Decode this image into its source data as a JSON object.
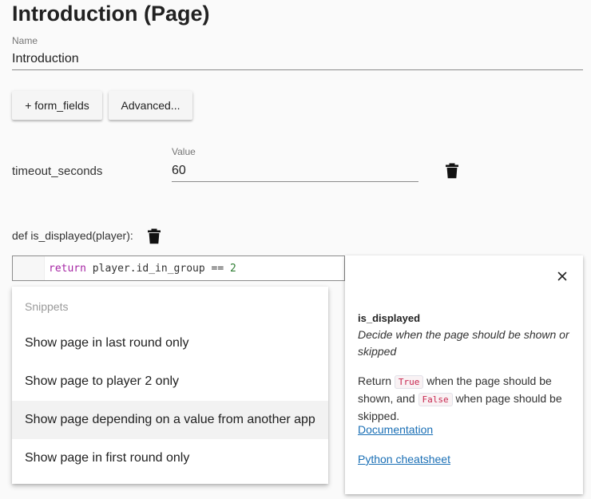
{
  "page": {
    "title": "Introduction (Page)"
  },
  "name_field": {
    "label": "Name",
    "value": "Introduction"
  },
  "buttons": {
    "form_fields": "+ form_fields",
    "advanced": "Advanced..."
  },
  "timeout": {
    "label": "timeout_seconds",
    "value_label": "Value",
    "value": "60"
  },
  "is_displayed": {
    "signature": "def is_displayed(player):",
    "code": {
      "keyword": "return",
      "expression": " player.id_in_group == ",
      "number": "2"
    }
  },
  "snippets": {
    "header": "Snippets",
    "items": [
      "Show page in last round only",
      "Show page to player 2 only",
      "Show page depending on a value from another app",
      "Show page in first round only"
    ],
    "highlighted_index": 2
  },
  "info_panel": {
    "title": "is_displayed",
    "description": "Decide when the page should be shown or skipped",
    "text_part1": "Return ",
    "true_chip": "True",
    "text_part2": " when the page should be shown, and ",
    "false_chip": "False",
    "text_part3": " when page should be skipped.",
    "doc_link": "Documentation",
    "cheatsheet_link": "Python cheatsheet"
  },
  "icons": {
    "delete": "trash-icon",
    "close": "close-icon"
  },
  "colors": {
    "link": "#1a6fb5",
    "code_keyword": "#a626a4",
    "code_number": "#2e7d32",
    "chip_text": "#c7254e"
  }
}
